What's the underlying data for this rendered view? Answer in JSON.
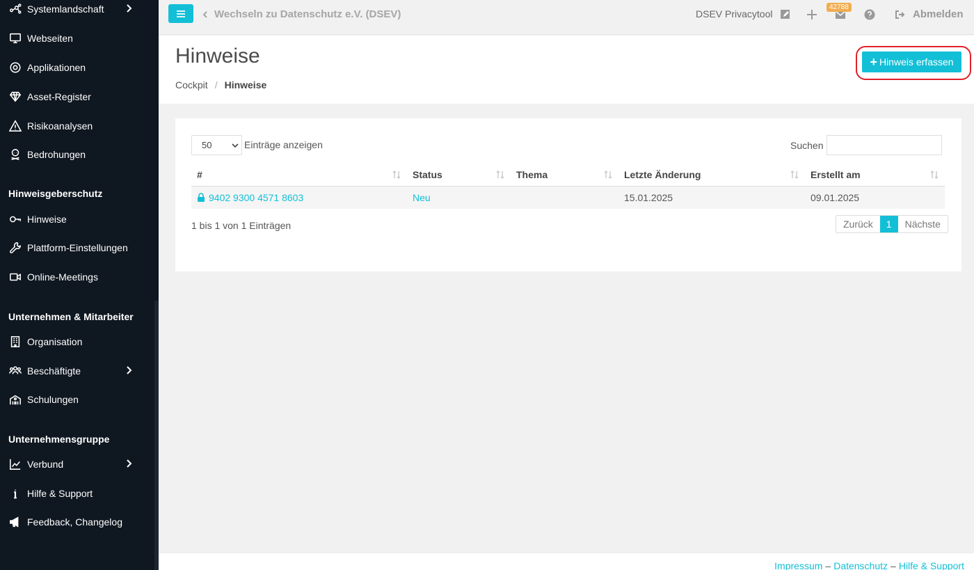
{
  "sidebar": {
    "items": [
      {
        "label": "Systemlandschaft",
        "icon": "network-icon",
        "chevron": true
      },
      {
        "label": "Webseiten",
        "icon": "monitor-icon"
      },
      {
        "label": "Applikationen",
        "icon": "target-icon"
      },
      {
        "label": "Asset-Register",
        "icon": "diamond-icon"
      },
      {
        "label": "Risikoanalysen",
        "icon": "warning-icon"
      },
      {
        "label": "Bedrohungen",
        "icon": "skull-icon"
      }
    ],
    "section1": "Hinweisgeberschutz",
    "items2": [
      {
        "label": "Hinweise",
        "icon": "key-icon"
      },
      {
        "label": "Plattform-Einstellungen",
        "icon": "wrench-icon"
      },
      {
        "label": "Online-Meetings",
        "icon": "video-icon"
      }
    ],
    "section2": "Unternehmen & Mitarbeiter",
    "items3": [
      {
        "label": "Organisation",
        "icon": "building-icon"
      },
      {
        "label": "Beschäftigte",
        "icon": "users-icon",
        "chevron": true
      },
      {
        "label": "Schulungen",
        "icon": "school-icon"
      }
    ],
    "section3": "Unternehmensgruppe",
    "items4": [
      {
        "label": "Verbund",
        "icon": "chart-icon",
        "chevron": true
      },
      {
        "label": "Hilfe & Support",
        "icon": "info-icon"
      },
      {
        "label": "Feedback, Changelog",
        "icon": "megaphone-icon"
      }
    ]
  },
  "topbar": {
    "switch_label": "Wechseln zu Datenschutz e.V. (DSEV)",
    "tool_name": "DSEV Privacytool",
    "mail_badge": "42788",
    "logout_label": "Abmelden"
  },
  "header": {
    "title": "Hinweise",
    "breadcrumb": [
      "Cockpit",
      "Hinweise"
    ],
    "add_button": "Hinweis erfassen"
  },
  "table_controls": {
    "length_value": "50",
    "length_label": "Einträge anzeigen",
    "search_label": "Suchen"
  },
  "table": {
    "columns": [
      "#",
      "Status",
      "Thema",
      "Letzte Änderung",
      "Erstellt am"
    ],
    "rows": [
      {
        "id": "9402 9300 4571 8603",
        "status": "Neu",
        "topic": "",
        "changed": "15.01.2025",
        "created": "09.01.2025"
      }
    ],
    "info": "1 bis 1 von 1 Einträgen",
    "pager": {
      "prev": "Zurück",
      "current": "1",
      "next": "Nächste"
    }
  },
  "footer": {
    "links": [
      "Impressum",
      "Datenschutz",
      "Hilfe & Support"
    ],
    "separator": "–"
  },
  "colors": {
    "accent": "#13bfd6",
    "sidebar_bg": "#0f1720",
    "highlight_ring": "#e0202a",
    "badge": "#f0ad4e"
  }
}
